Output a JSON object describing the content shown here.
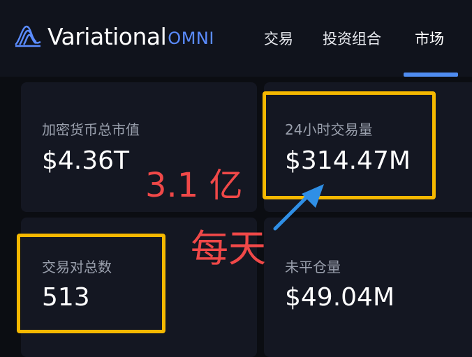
{
  "header": {
    "brand": "Variational",
    "brand_sub": "OMNI",
    "nav": [
      "交易",
      "投资组合",
      "市场"
    ],
    "active_nav": "市场"
  },
  "stats": [
    {
      "label": "加密货币总市值",
      "value": "$4.36T"
    },
    {
      "label": "24小时交易量",
      "value": "$314.47M"
    },
    {
      "label": "交易对总数",
      "value": "513"
    },
    {
      "label": "未平仓量",
      "value": "$49.04M"
    }
  ],
  "annotations": {
    "amount": "3.1 亿",
    "period": "每天",
    "highlight_color": "#f5b800",
    "text_color": "#f04848",
    "arrow_color": "#2f8fe6"
  },
  "colors": {
    "accent": "#4f8cf0",
    "background": "#0b0d12",
    "card": "#141722"
  }
}
